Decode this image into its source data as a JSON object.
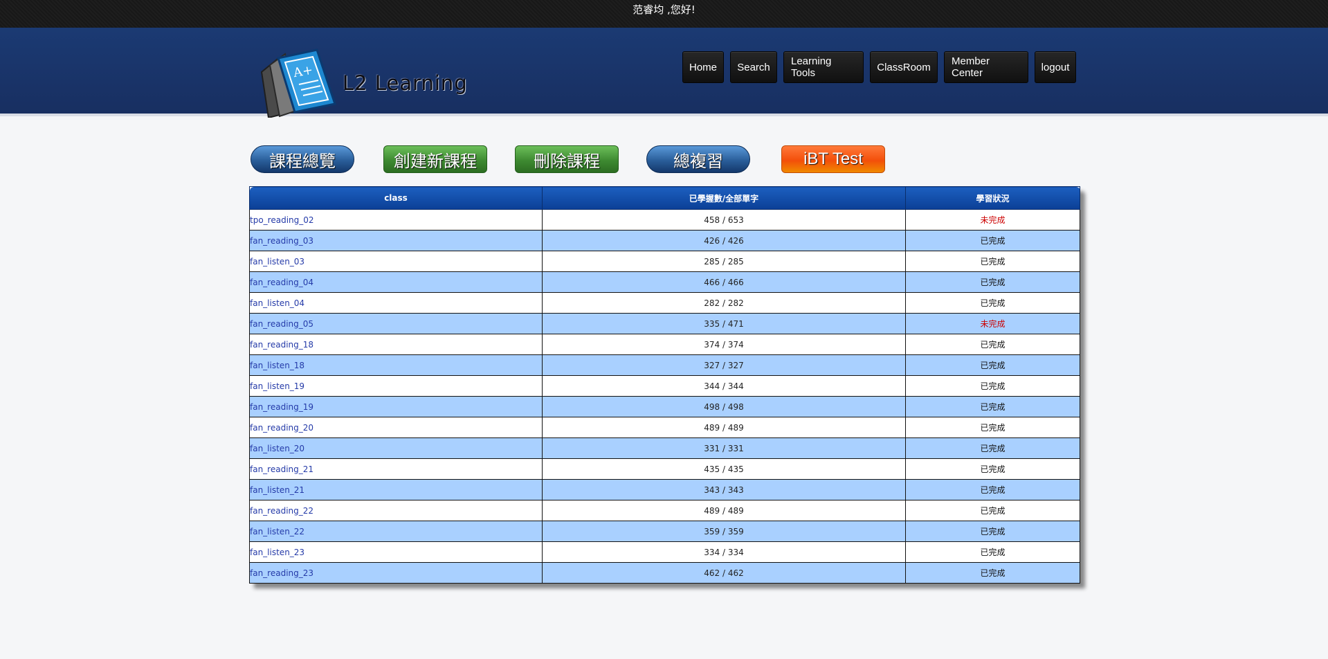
{
  "topbar": {
    "greeting": "范睿均 ,您好!"
  },
  "header": {
    "logo_text": "L2 Learning",
    "nav": [
      "Home",
      "Search",
      "Learning Tools",
      "ClassRoom",
      "Member Center",
      "logout"
    ]
  },
  "actions": {
    "course_overview": "課程總覽",
    "create_course": "創建新課程",
    "delete_course": "刪除課程",
    "total_review": "總複習",
    "ibt_test": "iBT Test"
  },
  "table": {
    "headers": [
      "class",
      "已學握數/全部單字",
      "學習狀況"
    ],
    "rows": [
      {
        "cls": "tpo_reading_02",
        "count": "458 / 653",
        "status": "未完成",
        "incomplete": true
      },
      {
        "cls": "fan_reading_03",
        "count": "426 / 426",
        "status": "已完成",
        "incomplete": false
      },
      {
        "cls": "fan_listen_03",
        "count": "285 / 285",
        "status": "已完成",
        "incomplete": false
      },
      {
        "cls": "fan_reading_04",
        "count": "466 / 466",
        "status": "已完成",
        "incomplete": false
      },
      {
        "cls": "fan_listen_04",
        "count": "282 / 282",
        "status": "已完成",
        "incomplete": false
      },
      {
        "cls": "fan_reading_05",
        "count": "335 / 471",
        "status": "未完成",
        "incomplete": true
      },
      {
        "cls": "fan_reading_18",
        "count": "374 / 374",
        "status": "已完成",
        "incomplete": false
      },
      {
        "cls": "fan_listen_18",
        "count": "327 / 327",
        "status": "已完成",
        "incomplete": false
      },
      {
        "cls": "fan_listen_19",
        "count": "344 / 344",
        "status": "已完成",
        "incomplete": false
      },
      {
        "cls": "fan_reading_19",
        "count": "498 / 498",
        "status": "已完成",
        "incomplete": false
      },
      {
        "cls": "fan_reading_20",
        "count": "489 / 489",
        "status": "已完成",
        "incomplete": false
      },
      {
        "cls": "fan_listen_20",
        "count": "331 / 331",
        "status": "已完成",
        "incomplete": false
      },
      {
        "cls": "fan_reading_21",
        "count": "435 / 435",
        "status": "已完成",
        "incomplete": false
      },
      {
        "cls": "fan_listen_21",
        "count": "343 / 343",
        "status": "已完成",
        "incomplete": false
      },
      {
        "cls": "fan_reading_22",
        "count": "489 / 489",
        "status": "已完成",
        "incomplete": false
      },
      {
        "cls": "fan_listen_22",
        "count": "359 / 359",
        "status": "已完成",
        "incomplete": false
      },
      {
        "cls": "fan_listen_23",
        "count": "334 / 334",
        "status": "已完成",
        "incomplete": false
      },
      {
        "cls": "fan_reading_23",
        "count": "462 / 462",
        "status": "已完成",
        "incomplete": false
      }
    ]
  },
  "colors": {
    "header_bg": "#1a3366",
    "row_alt": "#a9d0ff",
    "link": "#243aa8",
    "incomplete": "#cc0000"
  }
}
